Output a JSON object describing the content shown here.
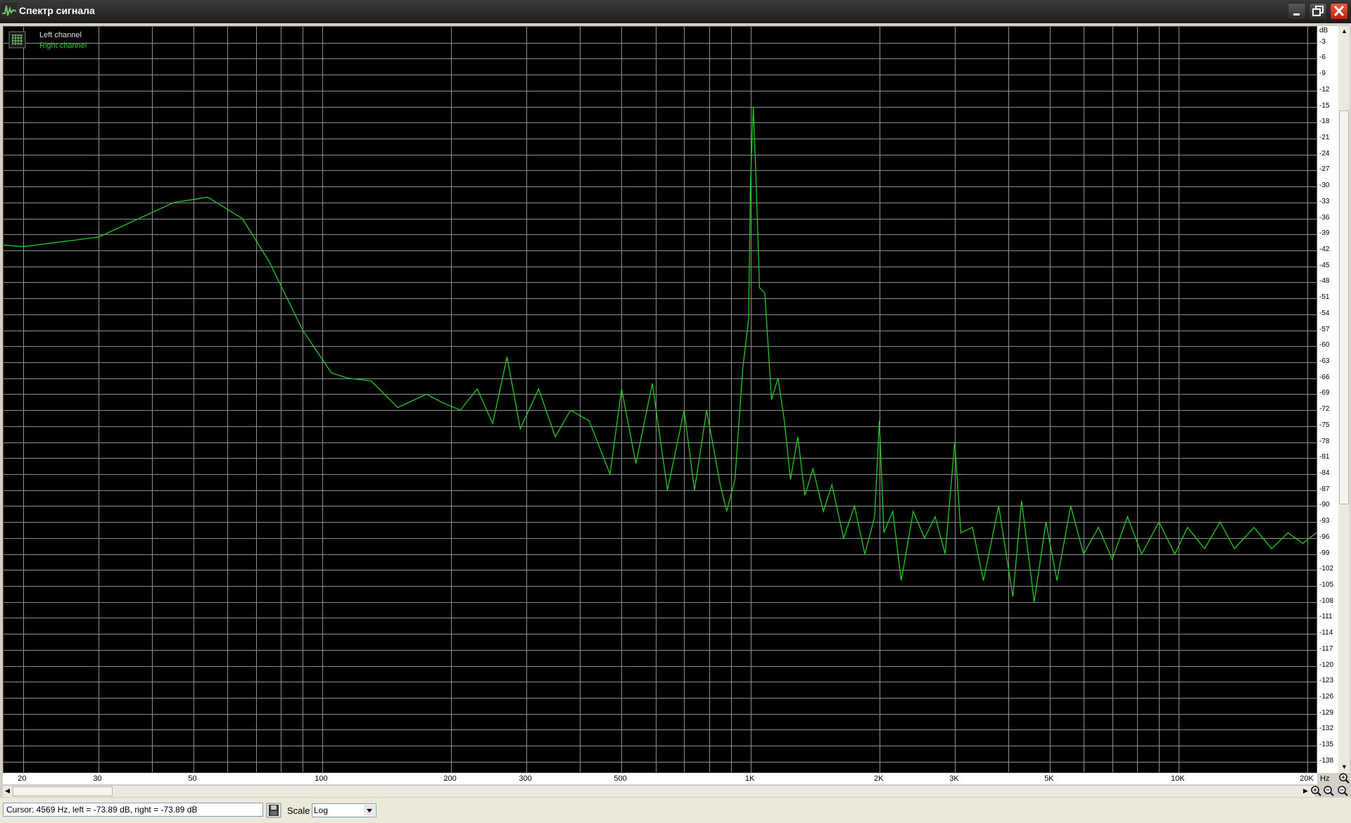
{
  "window": {
    "title": "Спектр сигнала"
  },
  "legend": {
    "left": "Left channel",
    "right": "Right channel"
  },
  "status": {
    "cursor": "Cursor:  4569 Hz,  left = -73.89 dB,  right = -73.89 dB",
    "scale_label": "Scale",
    "scale_value": "Log"
  },
  "axes": {
    "db_unit": "dB",
    "hz_unit": "Hz"
  },
  "colors": {
    "grid": "#8f8f8f",
    "trace": "#23c823",
    "background": "#000000"
  },
  "icons": [
    "app-waveform-icon",
    "minimize-icon",
    "maximize-icon",
    "close-icon",
    "grid-icon",
    "save-icon",
    "zoom-in-icon",
    "zoom-out-icon",
    "scroll-arrow-icon"
  ],
  "chart_data": {
    "type": "line",
    "title": "Спектр сигнала",
    "xlabel": "Hz",
    "ylabel": "dB",
    "xscale": "log",
    "xlim": [
      18,
      21000
    ],
    "ylim": [
      -140,
      0
    ],
    "grid": true,
    "legend": "top-left",
    "x_ticks": [
      {
        "v": 20,
        "label": "20"
      },
      {
        "v": 30,
        "label": "30"
      },
      {
        "v": 50,
        "label": "50"
      },
      {
        "v": 100,
        "label": "100"
      },
      {
        "v": 200,
        "label": "200"
      },
      {
        "v": 300,
        "label": "300"
      },
      {
        "v": 500,
        "label": "500"
      },
      {
        "v": 1000,
        "label": "1K"
      },
      {
        "v": 2000,
        "label": "2K"
      },
      {
        "v": 3000,
        "label": "3K"
      },
      {
        "v": 5000,
        "label": "5K"
      },
      {
        "v": 10000,
        "label": "10K"
      },
      {
        "v": 20000,
        "label": "20K"
      }
    ],
    "y_ticks": [
      -3,
      -6,
      -9,
      -12,
      -15,
      -18,
      -21,
      -24,
      -27,
      -30,
      -33,
      -36,
      -39,
      -42,
      -45,
      -48,
      -51,
      -54,
      -57,
      -60,
      -63,
      -66,
      -69,
      -72,
      -75,
      -78,
      -81,
      -84,
      -87,
      -90,
      -93,
      -96,
      -99,
      -102,
      -105,
      -108,
      -111,
      -114,
      -117,
      -120,
      -123,
      -126,
      -129,
      -132,
      -135,
      -138
    ],
    "series": [
      {
        "name": "Right channel",
        "color": "#23c823",
        "points": [
          [
            18,
            -41
          ],
          [
            20,
            -41.3
          ],
          [
            30,
            -39.5
          ],
          [
            45,
            -33
          ],
          [
            54,
            -32
          ],
          [
            65,
            -36
          ],
          [
            75,
            -44
          ],
          [
            90,
            -57
          ],
          [
            105,
            -65
          ],
          [
            115,
            -66
          ],
          [
            130,
            -66.5
          ],
          [
            150,
            -71.5
          ],
          [
            175,
            -69
          ],
          [
            190,
            -70.5
          ],
          [
            210,
            -72
          ],
          [
            230,
            -68
          ],
          [
            250,
            -74.5
          ],
          [
            270,
            -62
          ],
          [
            290,
            -75.5
          ],
          [
            320,
            -68
          ],
          [
            350,
            -77
          ],
          [
            380,
            -72
          ],
          [
            420,
            -74
          ],
          [
            470,
            -84
          ],
          [
            500,
            -68
          ],
          [
            540,
            -82
          ],
          [
            590,
            -67
          ],
          [
            640,
            -87
          ],
          [
            700,
            -72
          ],
          [
            740,
            -87
          ],
          [
            790,
            -72
          ],
          [
            850,
            -86
          ],
          [
            880,
            -91
          ],
          [
            920,
            -85
          ],
          [
            960,
            -64
          ],
          [
            990,
            -55
          ],
          [
            1000,
            -30
          ],
          [
            1015,
            -15
          ],
          [
            1030,
            -28
          ],
          [
            1050,
            -49
          ],
          [
            1080,
            -50
          ],
          [
            1120,
            -70
          ],
          [
            1160,
            -66
          ],
          [
            1200,
            -74
          ],
          [
            1240,
            -85
          ],
          [
            1290,
            -77
          ],
          [
            1340,
            -88
          ],
          [
            1400,
            -83
          ],
          [
            1480,
            -91
          ],
          [
            1550,
            -86
          ],
          [
            1650,
            -96
          ],
          [
            1750,
            -90
          ],
          [
            1850,
            -99
          ],
          [
            1950,
            -92
          ],
          [
            2000,
            -74
          ],
          [
            2050,
            -95
          ],
          [
            2150,
            -91
          ],
          [
            2250,
            -104
          ],
          [
            2400,
            -91
          ],
          [
            2550,
            -96
          ],
          [
            2700,
            -92
          ],
          [
            2850,
            -99
          ],
          [
            3000,
            -78
          ],
          [
            3100,
            -95
          ],
          [
            3300,
            -94
          ],
          [
            3500,
            -104
          ],
          [
            3800,
            -90
          ],
          [
            4100,
            -107
          ],
          [
            4300,
            -89
          ],
          [
            4600,
            -108
          ],
          [
            4900,
            -93
          ],
          [
            5200,
            -104
          ],
          [
            5600,
            -90
          ],
          [
            6000,
            -99
          ],
          [
            6500,
            -94
          ],
          [
            7000,
            -100
          ],
          [
            7600,
            -92
          ],
          [
            8200,
            -99
          ],
          [
            9000,
            -93
          ],
          [
            9800,
            -99
          ],
          [
            10500,
            -94
          ],
          [
            11500,
            -98
          ],
          [
            12500,
            -93
          ],
          [
            13500,
            -98
          ],
          [
            15000,
            -94
          ],
          [
            16500,
            -98
          ],
          [
            18000,
            -95
          ],
          [
            19500,
            -97
          ],
          [
            21000,
            -95
          ]
        ]
      }
    ]
  }
}
